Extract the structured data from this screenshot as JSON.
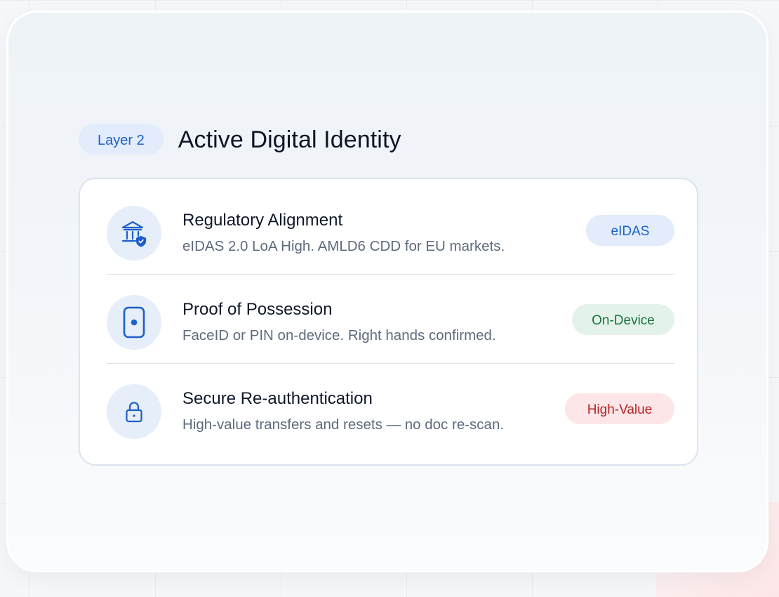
{
  "header": {
    "layer_label": "Layer 2",
    "title": "Active Digital Identity"
  },
  "items": [
    {
      "icon": "bank-shield-icon",
      "title": "Regulatory Alignment",
      "description": "eIDAS 2.0 LoA High. AMLD6 CDD for EU markets.",
      "badge": "eIDAS",
      "badge_color": "#1d5fc9"
    },
    {
      "icon": "device-icon",
      "title": "Proof of Possession",
      "description": "FaceID or PIN on-device. Right hands confirmed.",
      "badge": "On-Device",
      "badge_color": "#17743f"
    },
    {
      "icon": "lock-icon",
      "title": "Secure Re-authentication",
      "description": "High-value transfers and resets — no doc re-scan.",
      "badge": "High-Value",
      "badge_color": "#b22226"
    }
  ],
  "colors": {
    "accent": "#1d5fc9",
    "icon_bg": "#e6eef9"
  }
}
